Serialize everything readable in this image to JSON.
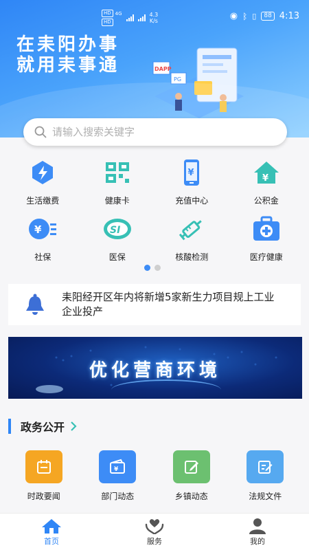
{
  "status_bar": {
    "network_left": "HD",
    "network_type": "4G",
    "speed": "4.3",
    "speed_unit": "K/s",
    "battery": "88",
    "time": "4:13"
  },
  "hero": {
    "slogan_line1": "在耒阳办事",
    "slogan_line2": "就用耒事通",
    "illustration_tags": [
      "DAPP",
      "PG"
    ]
  },
  "search": {
    "placeholder": "请输入搜索关键字"
  },
  "quick_services": [
    {
      "label": "生活缴费",
      "icon": "bolt-icon",
      "color": "#3d8cf6"
    },
    {
      "label": "健康卡",
      "icon": "qr-card-icon",
      "color": "#37c0b5"
    },
    {
      "label": "充值中心",
      "icon": "phone-yuan-icon",
      "color": "#3d8cf6"
    },
    {
      "label": "公积金",
      "icon": "house-yuan-icon",
      "color": "#37c0b5"
    },
    {
      "label": "社保",
      "icon": "yuan-coin-icon",
      "color": "#3d8cf6"
    },
    {
      "label": "医保",
      "icon": "si-badge-icon",
      "color": "#37c0b5"
    },
    {
      "label": "核酸检测",
      "icon": "syringe-icon",
      "color": "#37c0b5"
    },
    {
      "label": "医疗健康",
      "icon": "medical-kit-icon",
      "color": "#3d8cf6"
    }
  ],
  "pager": {
    "count": 2,
    "active": 0
  },
  "notice": {
    "text": "耒阳经开区年内将新增5家新生力项目规上工业企业投产"
  },
  "banner": {
    "title": "优化营商环境"
  },
  "gov_section": {
    "title": "政务公开",
    "items": [
      {
        "label": "时政要闻",
        "icon": "calendar-icon",
        "color": "#f5a623"
      },
      {
        "label": "部门动态",
        "icon": "wallet-icon",
        "color": "#3d8cf6"
      },
      {
        "label": "乡镇动态",
        "icon": "edit-icon",
        "color": "#6cc070"
      },
      {
        "label": "法规文件",
        "icon": "document-edit-icon",
        "color": "#56a9f0"
      }
    ]
  },
  "tabs": [
    {
      "label": "首页",
      "icon": "home-icon",
      "active": true
    },
    {
      "label": "服务",
      "icon": "heart-hands-icon",
      "active": false
    },
    {
      "label": "我的",
      "icon": "user-icon",
      "active": false
    }
  ],
  "colors": {
    "primary": "#2f86f6",
    "teal": "#37c0b5",
    "bell": "#3d6fd6"
  }
}
